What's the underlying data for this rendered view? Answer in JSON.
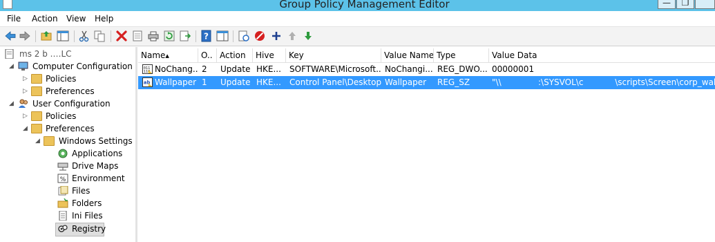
{
  "window": {
    "title": "Group Policy Management Editor",
    "minimize": "—",
    "restore": "❐"
  },
  "menu": [
    "File",
    "Action",
    "View",
    "Help"
  ],
  "tree": {
    "root_label": "ms            2  b           .…LC",
    "computer_config": "Computer Configuration",
    "cc_policies": "Policies",
    "cc_preferences": "Preferences",
    "user_config": "User Configuration",
    "uc_policies": "Policies",
    "uc_preferences": "Preferences",
    "windows_settings": "Windows Settings",
    "applications": "Applications",
    "drive_maps": "Drive Maps",
    "environment": "Environment",
    "files": "Files",
    "folders": "Folders",
    "ini_files": "Ini Files",
    "registry": "Registry"
  },
  "columns": [
    "Name",
    "O..",
    "Action",
    "Hive",
    "Key",
    "Value Name",
    "Type",
    "Value Data"
  ],
  "sort_indicator": "▴",
  "rows": [
    {
      "name": "NoChang...",
      "order": "2",
      "action": "Update",
      "hive": "HKE...",
      "key": "SOFTWARE\\Microsoft...",
      "value_name": "NoChangi...",
      "type": "REG_DWO...",
      "value_data": "00000001"
    },
    {
      "name": "Wallpaper",
      "order": "1",
      "action": "Update",
      "hive": "HKE...",
      "key": "Control Panel\\Desktop",
      "value_name": "Wallpaper",
      "type": "REG_SZ",
      "value_data": "\"\\\\​              :\\SYSVOL\\c            \\scripts\\Screen\\corp_wallpaper.jpg\""
    }
  ]
}
